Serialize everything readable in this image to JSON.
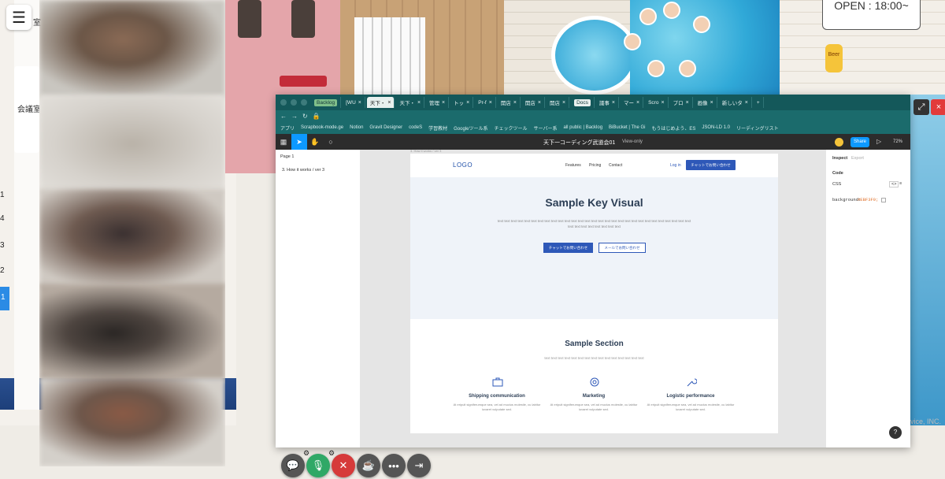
{
  "map": {
    "room_label_top": "室",
    "meeting_room_label": "会議室",
    "side_numbers": [
      "1",
      "4",
      "3",
      "2",
      "1"
    ],
    "open_sign": "OPEN : 18:00~",
    "beer_label": "Beer",
    "copyright": "vice, INC."
  },
  "browser": {
    "tabs": [
      {
        "label": "Backlog",
        "type": "badge"
      },
      {
        "label": "[WU"
      },
      {
        "label": "天下・",
        "active": true
      },
      {
        "label": "天下・"
      },
      {
        "label": "管理"
      },
      {
        "label": "トッ"
      },
      {
        "label": "Pr-f"
      },
      {
        "label": "開店"
      },
      {
        "label": "開店"
      },
      {
        "label": "開店"
      },
      {
        "label": "Docs",
        "type": "badge2"
      },
      {
        "label": "議事"
      },
      {
        "label": "マー"
      },
      {
        "label": "Scro"
      },
      {
        "label": "プロ"
      },
      {
        "label": "画像"
      },
      {
        "label": "新しいタ"
      }
    ],
    "bookmarks": [
      "アプリ",
      "Scrapbook-mode.ge",
      "Notion",
      "Gravit Designer",
      "codeS",
      "学習教材",
      "Googleツール系",
      "チェックツール",
      "サーバー系",
      "all public | Backlog",
      "BiBucket | The Gi",
      "もうはじめよう、ES",
      "JSON-LD 1.0",
      "リーディングリスト"
    ]
  },
  "figma": {
    "file_name": "天下一コーディング武道会01",
    "view_only": "View-only",
    "share_label": "Share",
    "zoom": "72%",
    "page_label": "Page 1",
    "layer_item": "3. How it works / ver 3",
    "frame_label": "3. How it works / ver 3",
    "inspect_tab": "Inspect",
    "export_tab": "Export",
    "code_label": "Code",
    "css_label": "CSS",
    "css_property": "background:",
    "css_value": "#EBF3F9;"
  },
  "design": {
    "logo": "LOGO",
    "nav_links": [
      "Features",
      "Pricing",
      "Contact"
    ],
    "login": "Log in",
    "nav_cta": "チャットでお問い合わせ",
    "hero_title": "Sample Key Visual",
    "hero_text": "text text text text text text text text text text text text text text text text text text text text text text text text text text text text text text text text text text text text text",
    "hero_btn_primary": "チャットでお問い合わせ",
    "hero_btn_secondary": "メールでお問い合わせ",
    "section_title": "Sample Section",
    "section_text": "text text text text text text text text text text text text text text text",
    "features": [
      {
        "title": "Shipping communication",
        "desc": "At eripuit signiferumque sea, vel ad mucius molestie, cu labitur iuvaret vulputate sed.",
        "icon": "briefcase-icon"
      },
      {
        "title": "Marketing",
        "desc": "At eripuit signiferumque sea, vel ad mucius molestie, cu labitur iuvaret vulputate sed.",
        "icon": "lifebuoy-icon"
      },
      {
        "title": "Logistic performance",
        "desc": "At eripuit signiferumque sea, vel ad mucius molestie, cu labitur iuvaret vulputate sed.",
        "icon": "wrench-icon"
      }
    ],
    "help": "?"
  },
  "controls": {
    "bottom_bar": [
      "chat-icon",
      "mic-icon",
      "camera-off-icon",
      "coffee-icon",
      "more-icon",
      "exit-icon"
    ]
  },
  "colors": {
    "figma_blue": "#0d99ff",
    "design_blue": "#2e58b8",
    "browser_teal": "#14585a",
    "mic_green": "#2fa866",
    "camera_red": "#d63a3a"
  }
}
